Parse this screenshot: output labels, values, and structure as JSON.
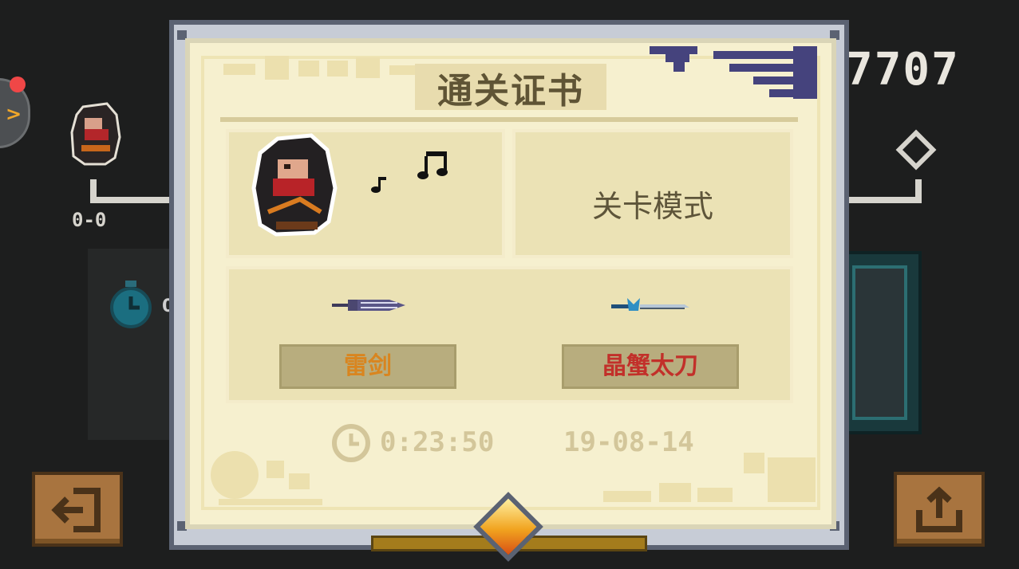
{
  "background": {
    "score_text": "7707",
    "level_text": "0-0",
    "time_partial": "0"
  },
  "certificate": {
    "title": "通关证书",
    "mode": "关卡模式",
    "weapons": [
      {
        "name": "雷剑",
        "color": "#d9851f"
      },
      {
        "name": "晶蟹太刀",
        "color": "#c2302a"
      }
    ],
    "time": "0:23:50",
    "date": "19-08-14"
  },
  "buttons": {
    "exit": "exit-door-icon",
    "share": "share-upload-icon"
  }
}
